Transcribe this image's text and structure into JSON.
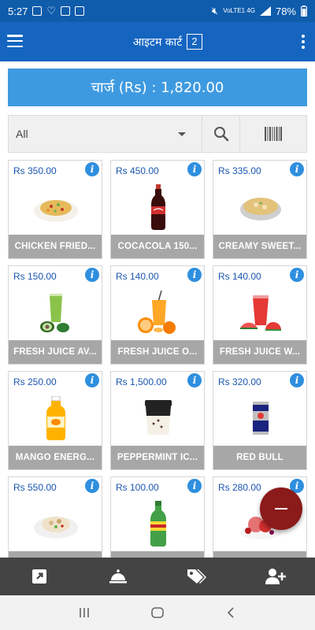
{
  "status_bar": {
    "time": "5:27",
    "network": "VoLTE1 4G",
    "battery": "78%"
  },
  "app_bar": {
    "title": "आइटम कार्ट",
    "cart_count": "2",
    "icons": {
      "menu": "hamburger-icon",
      "more": "vertical-dots-icon"
    }
  },
  "charge": {
    "label": "चार्ज (Rs) : 1,820.00"
  },
  "filter": {
    "category_selected": "All",
    "icons": {
      "search": "search-icon",
      "barcode": "barcode-icon",
      "dropdown": "caret-down-icon"
    }
  },
  "products": [
    {
      "price": "Rs 350.00",
      "name": "CHICKEN FRIED...",
      "image": "fried-rice"
    },
    {
      "price": "Rs 450.00",
      "name": "COCACOLA 150...",
      "image": "cola-bottle"
    },
    {
      "price": "Rs 335.00",
      "name": "CREAMY SWEET...",
      "image": "soup-bowl"
    },
    {
      "price": "Rs 150.00",
      "name": "FRESH JUICE AV...",
      "image": "avocado-juice"
    },
    {
      "price": "Rs 140.00",
      "name": "FRESH JUICE O...",
      "image": "orange-juice"
    },
    {
      "price": "Rs 140.00",
      "name": "FRESH JUICE W...",
      "image": "watermelon-juice"
    },
    {
      "price": "Rs 250.00",
      "name": "MANGO ENERG...",
      "image": "mango-bottle"
    },
    {
      "price": "Rs 1,500.00",
      "name": "PEPPERMINT IC...",
      "image": "ice-cream-tub"
    },
    {
      "price": "Rs 320.00",
      "name": "RED BULL",
      "image": "energy-can"
    },
    {
      "price": "Rs 550.00",
      "name": "",
      "image": "salad-plate"
    },
    {
      "price": "Rs 100.00",
      "name": "",
      "image": "soda-bottle"
    },
    {
      "price": "Rs 280.00",
      "name": "",
      "image": "berry-dessert"
    }
  ],
  "info_icon_label": "i",
  "bottom_nav": {
    "icons": [
      "open-external-icon",
      "service-bell-icon",
      "price-tags-icon",
      "add-user-icon"
    ]
  },
  "fab": {
    "icon": "minus-icon"
  },
  "system_nav": {
    "icons": [
      "recent-apps-icon",
      "home-icon",
      "back-icon"
    ]
  },
  "colors": {
    "status_bar": "#0f5cab",
    "app_bar": "#1565c0",
    "charge_bar": "#3e9ae0",
    "price_text": "#1a56b0",
    "info_badge": "#2f8fdf",
    "name_strip": "#a7a7a7",
    "fab": "#8b1a1a",
    "bottom_nav": "#444444"
  }
}
